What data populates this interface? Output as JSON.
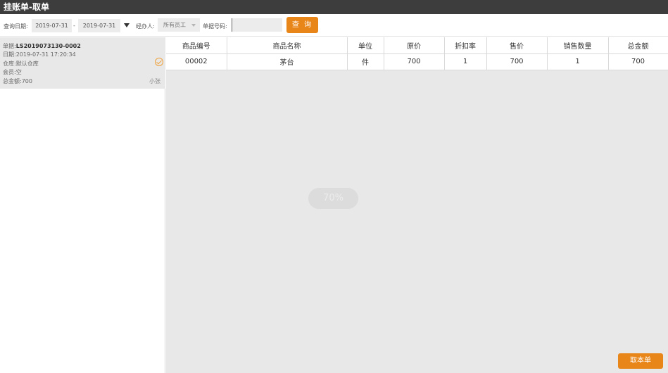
{
  "window": {
    "title": "挂账单-取单"
  },
  "filters": {
    "date_label": "查询日期:",
    "date_from": "2019-07-31",
    "date_sep": "-",
    "date_to": "2019-07-31",
    "handler_label": "经办人:",
    "handler_value": "所有员工",
    "doc_no_label": "单据号码:",
    "doc_no_value": "",
    "query_button": "查 询"
  },
  "orders": [
    {
      "no_label": "单据:",
      "no": "LS2019073130-0002",
      "date": "日期:2019-07-31 17:20:34",
      "warehouse": "仓库:默认仓库",
      "member": "会员:空",
      "total": "总金额:700",
      "operator": "小张",
      "selected": true
    }
  ],
  "table": {
    "headers": [
      "商品编号",
      "商品名称",
      "单位",
      "原价",
      "折扣率",
      "售价",
      "销售数量",
      "总金额"
    ],
    "rows": [
      [
        "00002",
        "茅台",
        "件",
        "700",
        "1",
        "700",
        "1",
        "700"
      ]
    ]
  },
  "loading_toast": "70%",
  "take_button": "取本单",
  "colors": {
    "accent": "#e8861a",
    "titlebar": "#3d3d3d",
    "panel": "#e8e8e8"
  }
}
